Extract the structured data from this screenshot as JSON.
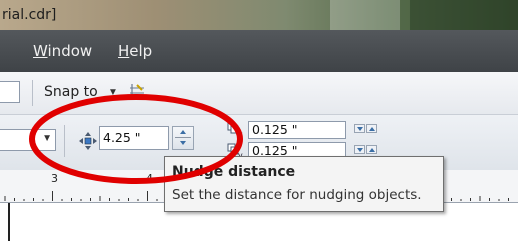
{
  "window": {
    "title": "rial.cdr]"
  },
  "menubar": {
    "items": [
      {
        "label": "Window",
        "underline": "W",
        "rest": "indow"
      },
      {
        "label": "Help",
        "underline": "H",
        "rest": "elp"
      }
    ]
  },
  "toolbar": {
    "snap_label": "Snap to"
  },
  "property_bar": {
    "nudge_distance_value": "4.25 \"",
    "duplicate_x_value": "0.125 \"",
    "duplicate_y_value": "0.125 \""
  },
  "ruler": {
    "labels": [
      "3",
      "4"
    ]
  },
  "tooltip": {
    "title": "Nudge distance",
    "description": "Set the distance for nudging objects."
  },
  "colors": {
    "annotation": "#e00000",
    "menubar": "#474b4f",
    "tooltip_background": "#f4f4f4"
  }
}
